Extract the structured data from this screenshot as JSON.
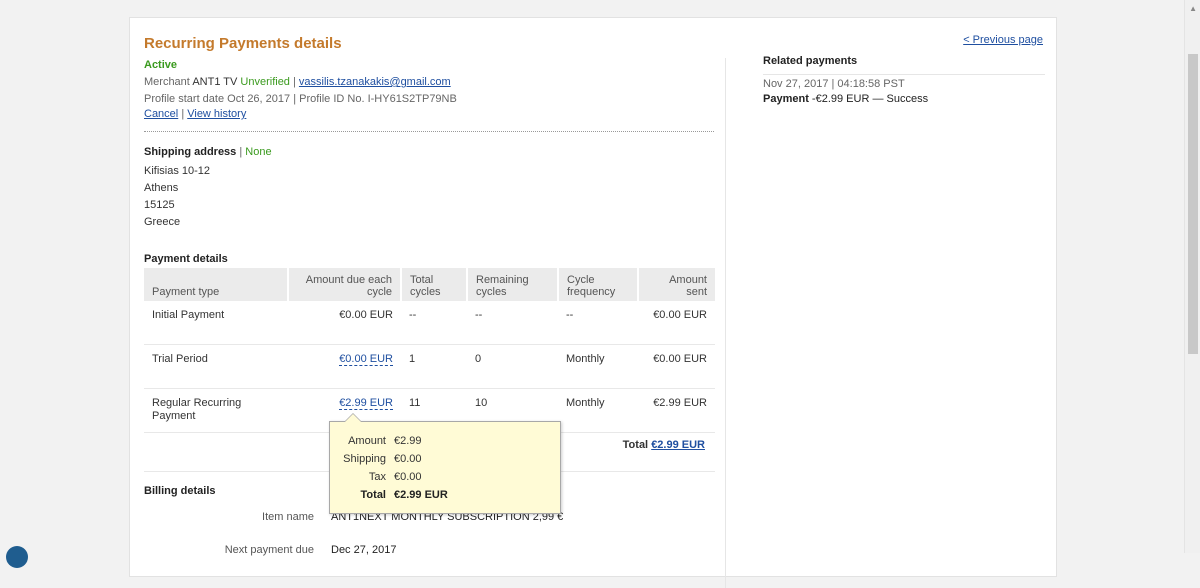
{
  "page": {
    "title": "Recurring Payments details",
    "status": "Active",
    "previous_page": "< Previous page"
  },
  "merchant": {
    "label": "Merchant",
    "name": "ANT1 TV",
    "verification": "Unverified",
    "separator": "|",
    "email": "vassilis.tzanakakis@gmail.com"
  },
  "profile": {
    "start_text": "Profile start date Oct 26, 2017 | Profile ID No. I-HY61S2TP79NB"
  },
  "actions": {
    "cancel": "Cancel",
    "separator": "|",
    "view_history": "View history"
  },
  "shipping": {
    "label": "Shipping address",
    "separator": "|",
    "status": "None",
    "lines": [
      "Kifisias 10-12",
      "Athens",
      "15125",
      "Greece"
    ]
  },
  "payment_details": {
    "title": "Payment details",
    "columns": [
      "Payment type",
      "Amount due each cycle",
      "Total cycles",
      "Remaining cycles",
      "Cycle frequency",
      "Amount sent"
    ],
    "rows": [
      {
        "type": "Initial Payment",
        "amount": "€0.00 EUR",
        "total": "--",
        "remaining": "--",
        "frequency": "--",
        "sent": "€0.00 EUR"
      },
      {
        "type": "Trial Period",
        "amount": "€0.00 EUR",
        "total": "1",
        "remaining": "0",
        "frequency": "Monthly",
        "sent": "€0.00 EUR"
      },
      {
        "type": "Regular Recurring Payment",
        "amount": "€2.99 EUR",
        "total": "11",
        "remaining": "10",
        "frequency": "Monthly",
        "sent": "€2.99 EUR"
      }
    ],
    "total_label": "Total",
    "total_value": "€2.99 EUR"
  },
  "tooltip": {
    "amount_label": "Amount",
    "amount_value": "€2.99",
    "shipping_label": "Shipping",
    "shipping_value": "€0.00",
    "tax_label": "Tax",
    "tax_value": "€0.00",
    "total_label": "Total",
    "total_value": "€2.99 EUR"
  },
  "billing": {
    "title": "Billing details",
    "item_name_label": "Item name",
    "item_name_value": "ANT1NEXT MONTHLY SUBSCRIPTION 2,99 €",
    "next_due_label": "Next payment due",
    "next_due_value": "Dec 27, 2017"
  },
  "related": {
    "title": "Related payments",
    "date": "Nov 27, 2017 | 04:18:58 PST",
    "payment_label": "Payment",
    "payment_text": "-€2.99 EUR — Success"
  },
  "colors": {
    "title": "#c47a2c",
    "status_green": "#3a9a1e",
    "link": "#1f4fa0",
    "tooltip_bg": "#fffbd6"
  }
}
